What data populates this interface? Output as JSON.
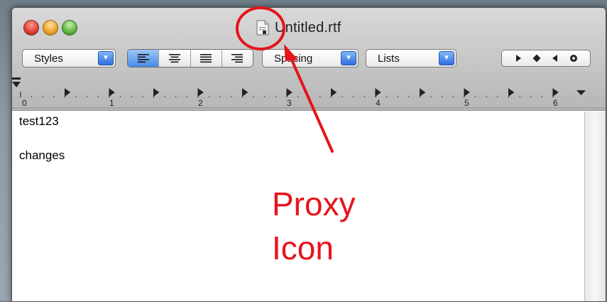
{
  "window": {
    "title": "Untitled.rtf",
    "icons": {
      "proxy": "document-proxy-icon",
      "close": "close-button",
      "minimize": "minimize-button",
      "zoom": "zoom-button"
    }
  },
  "toolbar": {
    "styles_label": "Styles",
    "spacing_label": "Spacing",
    "lists_label": "Lists",
    "alignment": [
      "align-left",
      "align-center",
      "justify",
      "align-right"
    ],
    "alignment_selected": "align-left",
    "markers": [
      "play-right-icon",
      "diamond-icon",
      "play-left-icon",
      "circle-x-icon"
    ]
  },
  "ruler": {
    "numbers": [
      "0",
      "1",
      "2",
      "3",
      "4",
      "5",
      "6"
    ]
  },
  "document": {
    "lines": [
      "test123",
      "changes"
    ]
  },
  "annotation": {
    "line1": "Proxy",
    "line2": "Icon"
  },
  "colors": {
    "annotation": "#e6141b",
    "accent_blue": "#3a7ae4"
  }
}
